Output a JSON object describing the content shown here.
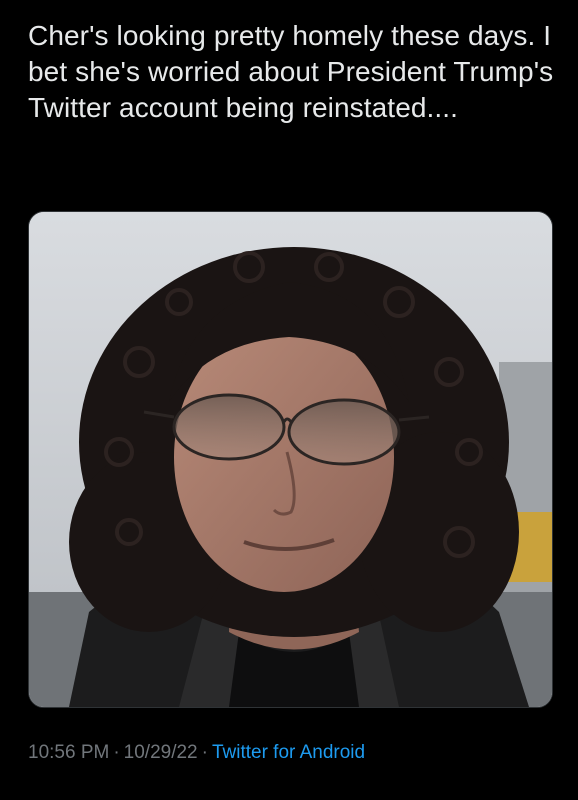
{
  "tweet": {
    "text": "Cher's looking pretty homely these days. I bet she's worried about President Trump's Twitter account being reinstated....",
    "time": "10:56 PM",
    "separator": "·",
    "date": "10/29/22",
    "source": "Twitter for Android"
  },
  "colors": {
    "background": "#000000",
    "text": "#e7e9ea",
    "meta": "#71767b",
    "link": "#1d9bf0"
  }
}
